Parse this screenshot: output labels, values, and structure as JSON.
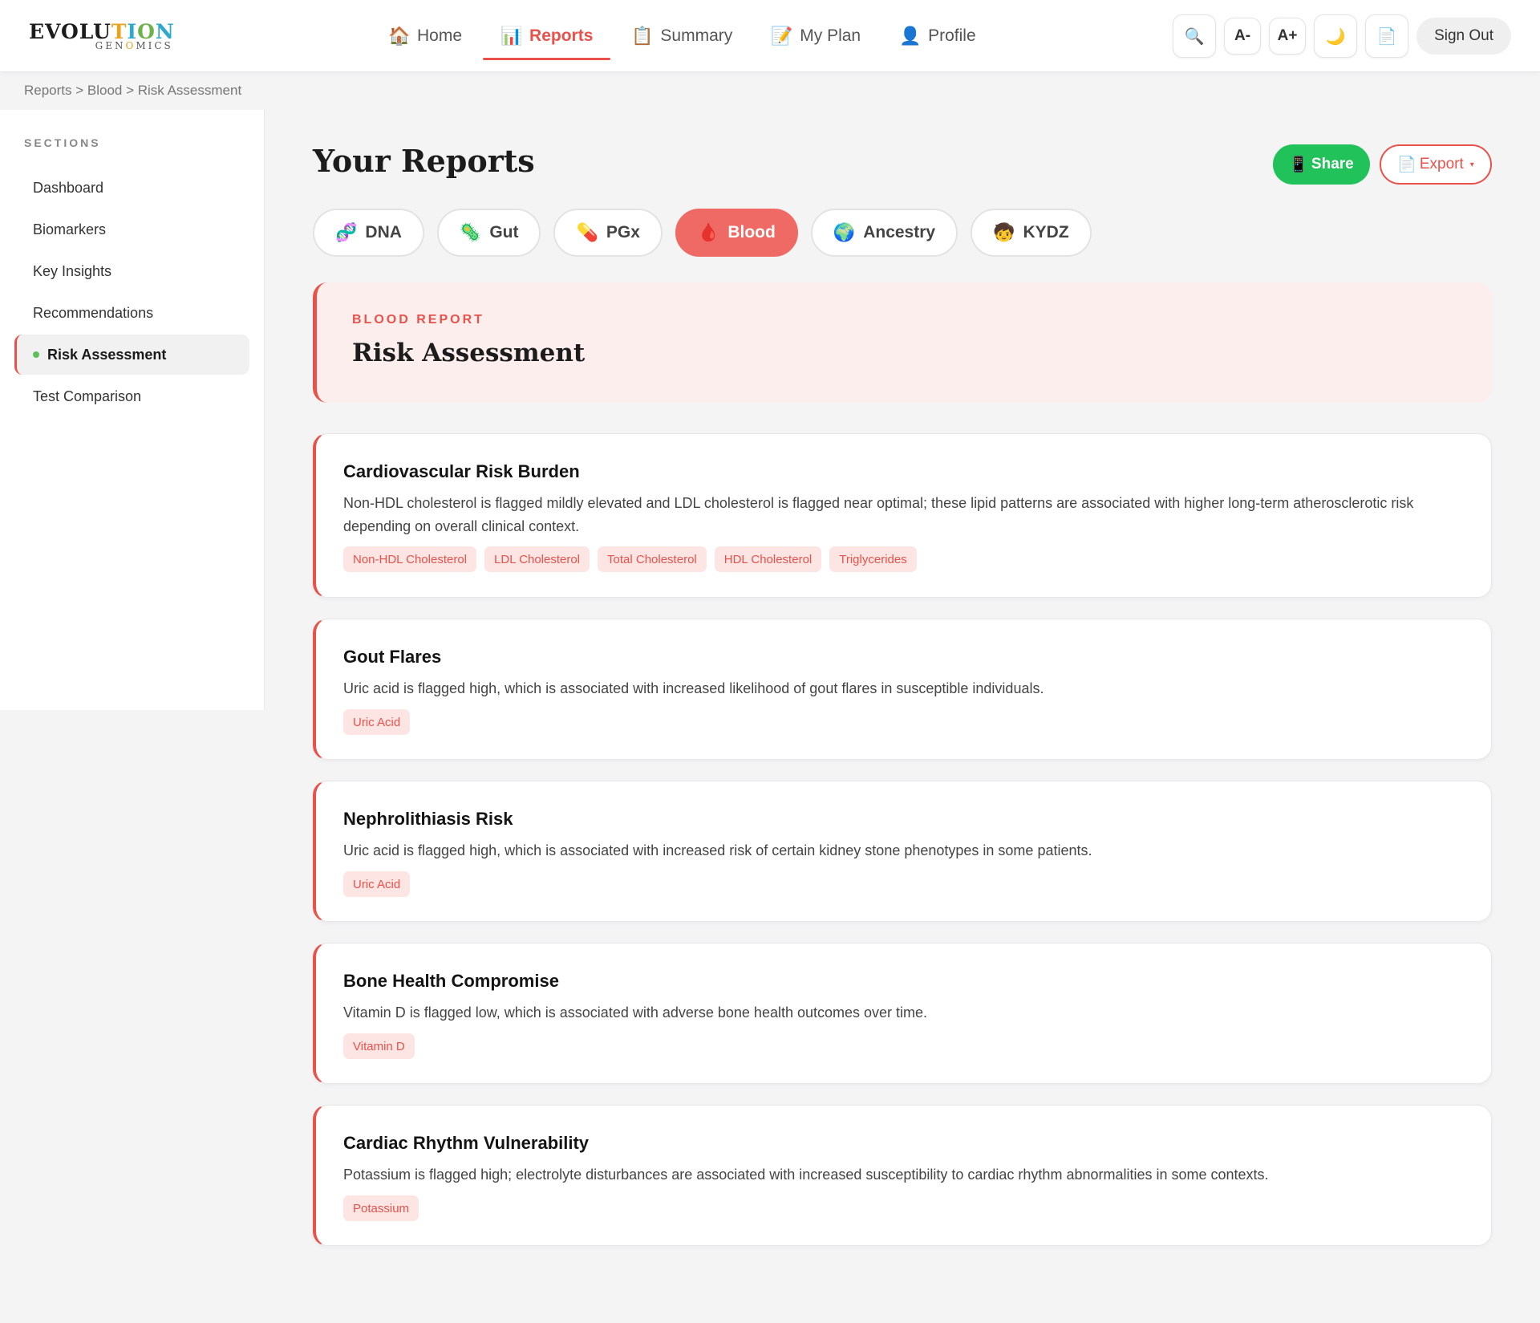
{
  "brand": {
    "word_parts": [
      "EVOLU",
      "T",
      "I",
      "O",
      "N"
    ],
    "sub_parts": [
      "GEN",
      "O",
      "MICS"
    ]
  },
  "nav": [
    {
      "label": "Home",
      "icon": "🏠",
      "icon_name": "house-icon"
    },
    {
      "label": "Reports",
      "icon": "📊",
      "icon_name": "bar-chart-icon",
      "active": true
    },
    {
      "label": "Summary",
      "icon": "📋",
      "icon_name": "clipboard-icon"
    },
    {
      "label": "My Plan",
      "icon": "📝",
      "icon_name": "memo-icon"
    },
    {
      "label": "Profile",
      "icon": "👤",
      "icon_name": "user-icon"
    }
  ],
  "tools": {
    "search_icon": "🔍",
    "font_decrease": "A-",
    "font_increase": "A+",
    "dark_mode_icon": "🌙",
    "document_icon": "📄",
    "sign_out": "Sign Out"
  },
  "breadcrumb": "Reports > Blood > Risk Assessment",
  "sidebar": {
    "heading": "SECTIONS",
    "items": [
      {
        "label": "Dashboard"
      },
      {
        "label": "Biomarkers"
      },
      {
        "label": "Key Insights"
      },
      {
        "label": "Recommendations"
      },
      {
        "label": "Risk Assessment",
        "active": true
      },
      {
        "label": "Test Comparison"
      }
    ]
  },
  "main": {
    "title": "Your Reports",
    "share_label": "Share",
    "share_icon": "📱",
    "export_label": "Export",
    "export_icon": "📄",
    "export_caret": "▾",
    "tabs": [
      {
        "label": "DNA",
        "icon": "🧬"
      },
      {
        "label": "Gut",
        "icon": "🦠"
      },
      {
        "label": "PGx",
        "icon": "💊"
      },
      {
        "label": "Blood",
        "icon": "🩸",
        "active": true
      },
      {
        "label": "Ancestry",
        "icon": "🌍"
      },
      {
        "label": "KYDZ",
        "icon": "🧒"
      }
    ],
    "hero": {
      "kicker": "BLOOD REPORT",
      "title": "Risk Assessment"
    },
    "cards": [
      {
        "title": "Cardiovascular Risk Burden",
        "text": "Non-HDL cholesterol is flagged mildly elevated and LDL cholesterol is flagged near optimal; these lipid patterns are associated with higher long-term atherosclerotic risk depending on overall clinical context.",
        "tags": [
          "Non-HDL Cholesterol",
          "LDL Cholesterol",
          "Total Cholesterol",
          "HDL Cholesterol",
          "Triglycerides"
        ]
      },
      {
        "title": "Gout Flares",
        "text": "Uric acid is flagged high, which is associated with increased likelihood of gout flares in susceptible individuals.",
        "tags": [
          "Uric Acid"
        ]
      },
      {
        "title": "Nephrolithiasis Risk",
        "text": "Uric acid is flagged high, which is associated with increased risk of certain kidney stone phenotypes in some patients.",
        "tags": [
          "Uric Acid"
        ]
      },
      {
        "title": "Bone Health Compromise",
        "text": "Vitamin D is flagged low, which is associated with adverse bone health outcomes over time.",
        "tags": [
          "Vitamin D"
        ]
      },
      {
        "title": "Cardiac Rhythm Vulnerability",
        "text": "Potassium is flagged high; electrolyte disturbances are associated with increased susceptibility to cardiac rhythm abnormalities in some contexts.",
        "tags": [
          "Potassium"
        ]
      }
    ]
  },
  "colors": {
    "accent": "#e8524a",
    "share": "#22c25a",
    "active_dot": "#5fbf5a"
  }
}
